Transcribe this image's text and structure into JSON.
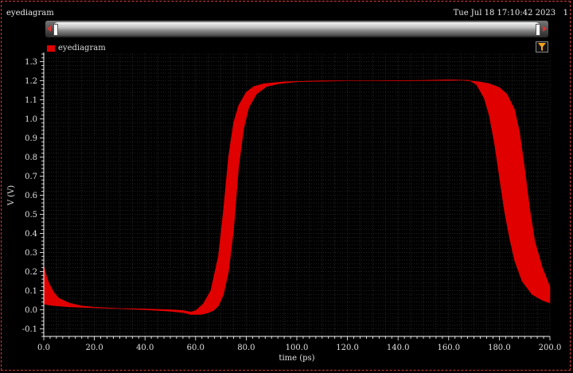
{
  "window": {
    "title": "eyediagram",
    "timestamp": "Tue Jul 18 17:10:42 2023",
    "page_indicator": "1"
  },
  "legend": {
    "label": "eyediagram",
    "color": "#e00000"
  },
  "toolbar": {
    "filter_icon": "filter-icon"
  },
  "colors": {
    "background": "#000000",
    "trace": "#e00000",
    "grid": "#3a3a3a",
    "axis": "#ffffff",
    "frame": "#d23b3b"
  },
  "chart_data": {
    "type": "area",
    "xlabel": "time (ps)",
    "ylabel": "V (V)",
    "xlim": [
      0,
      200
    ],
    "ylim": [
      -0.14,
      1.34
    ],
    "x_ticks": [
      "0.0",
      "20.0",
      "40.0",
      "60.0",
      "80.0",
      "100.0",
      "120.0",
      "140.0",
      "160.0",
      "180.0",
      "200.0"
    ],
    "y_ticks": [
      "-0.1",
      "0.0",
      "0.1",
      "0.2",
      "0.3",
      "0.4",
      "0.5",
      "0.6",
      "0.7",
      "0.8",
      "0.9",
      "1.0",
      "1.1",
      "1.2",
      "1.3"
    ],
    "grid": true,
    "series": [
      {
        "name": "eyediagram",
        "upper": [
          [
            0,
            0.23
          ],
          [
            1,
            0.18
          ],
          [
            2,
            0.14
          ],
          [
            4,
            0.09
          ],
          [
            6,
            0.06
          ],
          [
            10,
            0.035
          ],
          [
            15,
            0.02
          ],
          [
            20,
            0.013
          ],
          [
            30,
            0.007
          ],
          [
            40,
            0.004
          ],
          [
            50,
            0.0
          ],
          [
            55,
            -0.004
          ],
          [
            58,
            -0.012
          ],
          [
            60,
            -0.005
          ],
          [
            63,
            0.03
          ],
          [
            66,
            0.1
          ],
          [
            69,
            0.28
          ],
          [
            71,
            0.52
          ],
          [
            73,
            0.8
          ],
          [
            75,
            0.98
          ],
          [
            77,
            1.07
          ],
          [
            80,
            1.14
          ],
          [
            83,
            1.17
          ],
          [
            87,
            1.185
          ],
          [
            95,
            1.195
          ],
          [
            110,
            1.2
          ],
          [
            130,
            1.2
          ],
          [
            150,
            1.202
          ],
          [
            158,
            1.205
          ],
          [
            163,
            1.205
          ],
          [
            168,
            1.2
          ],
          [
            172,
            1.195
          ],
          [
            176,
            1.185
          ],
          [
            180,
            1.165
          ],
          [
            183,
            1.13
          ],
          [
            186,
            1.05
          ],
          [
            188,
            0.93
          ],
          [
            190,
            0.74
          ],
          [
            192,
            0.53
          ],
          [
            194,
            0.36
          ],
          [
            197,
            0.22
          ],
          [
            200,
            0.12
          ]
        ],
        "lower": [
          [
            0,
            0.03
          ],
          [
            2,
            0.025
          ],
          [
            5,
            0.02
          ],
          [
            10,
            0.015
          ],
          [
            20,
            0.01
          ],
          [
            30,
            0.006
          ],
          [
            40,
            0.0
          ],
          [
            50,
            -0.008
          ],
          [
            55,
            -0.015
          ],
          [
            58,
            -0.025
          ],
          [
            62,
            -0.025
          ],
          [
            64,
            -0.02
          ],
          [
            67,
            -0.005
          ],
          [
            69,
            0.02
          ],
          [
            71,
            0.08
          ],
          [
            73,
            0.2
          ],
          [
            75,
            0.42
          ],
          [
            77,
            0.75
          ],
          [
            79,
            0.95
          ],
          [
            81,
            1.06
          ],
          [
            84,
            1.13
          ],
          [
            88,
            1.17
          ],
          [
            93,
            1.185
          ],
          [
            100,
            1.195
          ],
          [
            120,
            1.2
          ],
          [
            140,
            1.2
          ],
          [
            160,
            1.202
          ],
          [
            168,
            1.203
          ],
          [
            171,
            1.18
          ],
          [
            174,
            1.11
          ],
          [
            176,
            1.02
          ],
          [
            178,
            0.88
          ],
          [
            180,
            0.7
          ],
          [
            182,
            0.52
          ],
          [
            184,
            0.38
          ],
          [
            186,
            0.26
          ],
          [
            189,
            0.15
          ],
          [
            193,
            0.08
          ],
          [
            197,
            0.05
          ],
          [
            200,
            0.035
          ]
        ]
      }
    ]
  }
}
